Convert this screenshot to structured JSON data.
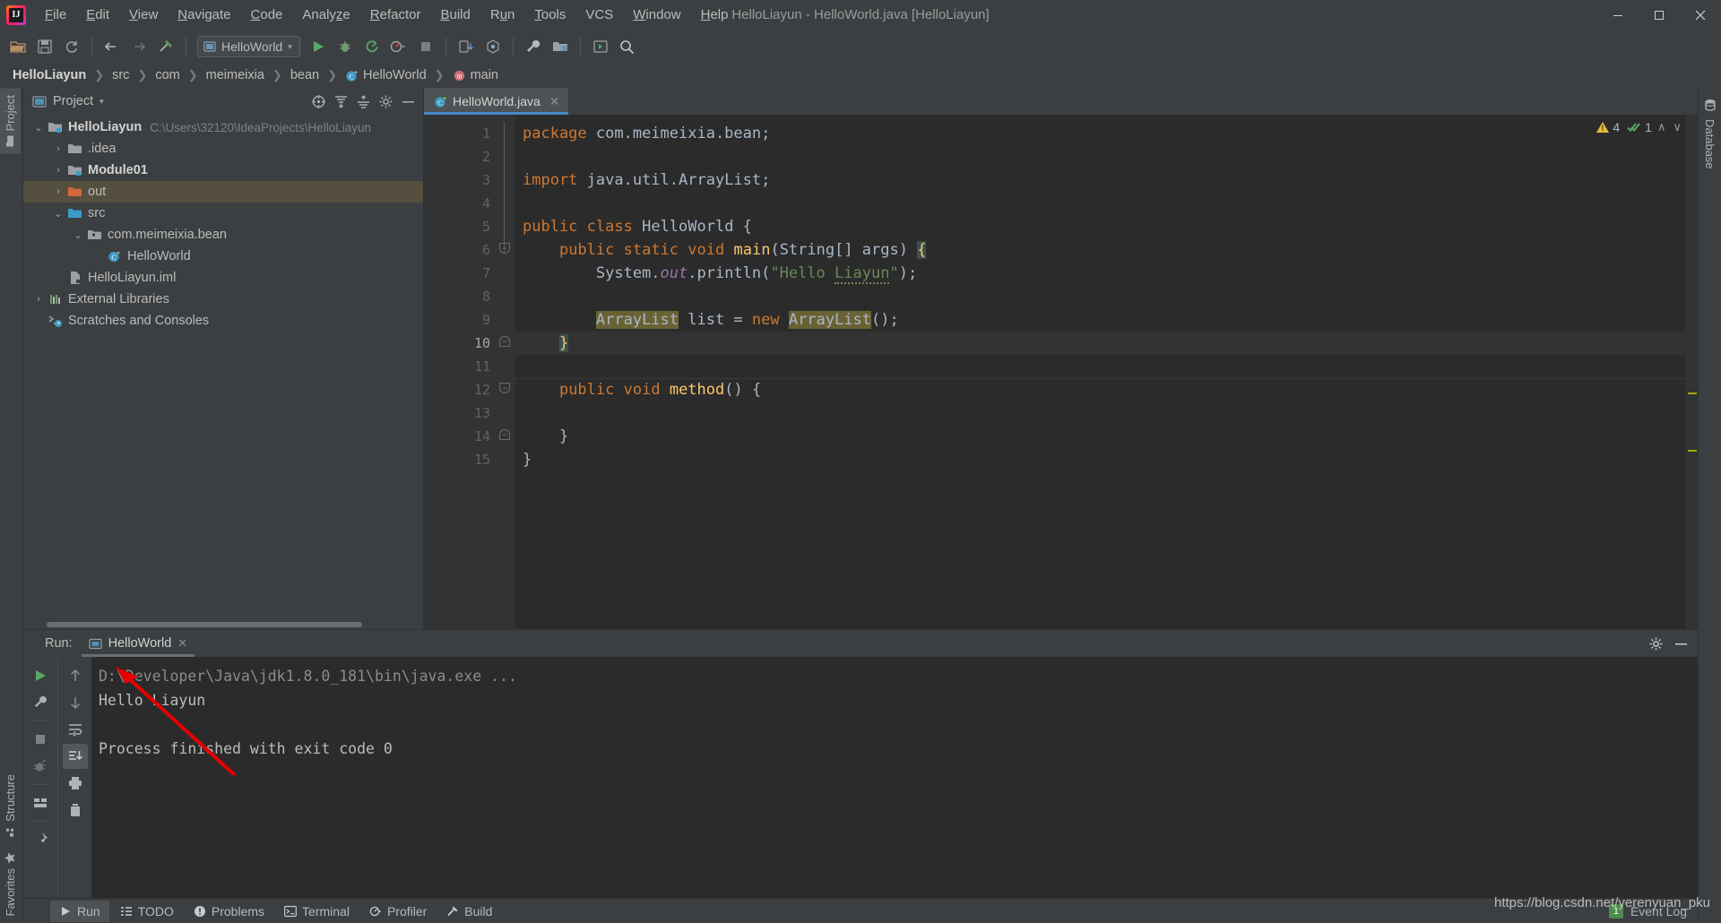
{
  "window": {
    "title": "HelloLiayun - HelloWorld.java [HelloLiayun]",
    "minimize": "–",
    "maximize": "❐",
    "close": "✕"
  },
  "menubar": {
    "items": [
      {
        "label": "File",
        "mnemonic": "F"
      },
      {
        "label": "Edit",
        "mnemonic": "E"
      },
      {
        "label": "View",
        "mnemonic": "V"
      },
      {
        "label": "Navigate",
        "mnemonic": "N"
      },
      {
        "label": "Code",
        "mnemonic": "C"
      },
      {
        "label": "Analyze",
        "mnemonic": "z"
      },
      {
        "label": "Refactor",
        "mnemonic": "R"
      },
      {
        "label": "Build",
        "mnemonic": "B"
      },
      {
        "label": "Run",
        "mnemonic": "u"
      },
      {
        "label": "Tools",
        "mnemonic": "T"
      },
      {
        "label": "VCS",
        "mnemonic": ""
      },
      {
        "label": "Window",
        "mnemonic": "W"
      },
      {
        "label": "Help",
        "mnemonic": "H"
      }
    ]
  },
  "toolbar": {
    "open_icon": "open-folder-icon",
    "save_icon": "save-all-icon",
    "sync_icon": "synchronize-icon",
    "back_icon": "navigate-back-icon",
    "forward_icon": "navigate-forward-icon",
    "build_icon": "build-hammer-icon",
    "run_config": "HelloWorld",
    "run_config_caret": "▾",
    "run_icon": "run-icon",
    "debug_icon": "debug-icon",
    "coverage_icon": "run-with-coverage-icon",
    "profile_icon": "profile-icon",
    "stop_icon": "stop-icon",
    "update_icon": "update-project-icon",
    "commit_icon": "commit-icon",
    "settings_icon": "settings-wrench-icon",
    "structure_icon": "project-structure-icon",
    "select_in_icon": "select-in-icon",
    "search_icon": "search-everywhere-icon"
  },
  "breadcrumb": {
    "separator": "❯",
    "items": [
      {
        "label": "HelloLiayun",
        "bold": true,
        "icon": ""
      },
      {
        "label": "src",
        "bold": false,
        "icon": ""
      },
      {
        "label": "com",
        "bold": false,
        "icon": ""
      },
      {
        "label": "meimeixia",
        "bold": false,
        "icon": ""
      },
      {
        "label": "bean",
        "bold": false,
        "icon": ""
      },
      {
        "label": "HelloWorld",
        "bold": false,
        "icon": "java-class-icon"
      },
      {
        "label": "main",
        "bold": false,
        "icon": "method-icon"
      }
    ]
  },
  "left_tool_tabs": [
    {
      "label": "Project",
      "icon": "project-folder-icon",
      "active": true
    },
    {
      "label": "Structure",
      "icon": "structure-icon",
      "active": false
    },
    {
      "label": "Favorites",
      "icon": "favorites-star-icon",
      "active": false
    }
  ],
  "right_tool_tabs": [
    {
      "label": "Database",
      "icon": "database-icon"
    }
  ],
  "project_panel": {
    "title": "Project",
    "caret": "▾",
    "actions": [
      {
        "name": "select-opened-file-icon",
        "label": "⊕"
      },
      {
        "name": "expand-all-icon",
        "label": "⤓"
      },
      {
        "name": "collapse-all-icon",
        "label": "⤒"
      },
      {
        "name": "settings-gear-icon",
        "label": "⚙"
      },
      {
        "name": "hide-panel-icon",
        "label": "–"
      }
    ],
    "tree": [
      {
        "label": "HelloLiayun",
        "path": "C:\\Users\\32120\\IdeaProjects\\HelloLiayun",
        "arrow": "⌄",
        "indent": 0,
        "icon": "project-root-icon",
        "bold": true,
        "selected": false
      },
      {
        "label": ".idea",
        "path": "",
        "arrow": "›",
        "indent": 1,
        "icon": "folder-icon",
        "bold": false,
        "selected": false
      },
      {
        "label": "Module01",
        "path": "",
        "arrow": "›",
        "indent": 1,
        "icon": "module-icon",
        "bold": true,
        "selected": false
      },
      {
        "label": "out",
        "path": "",
        "arrow": "›",
        "indent": 1,
        "icon": "folder-orange-icon",
        "bold": false,
        "selected": true
      },
      {
        "label": "src",
        "path": "",
        "arrow": "⌄",
        "indent": 1,
        "icon": "source-folder-icon",
        "bold": false,
        "selected": false
      },
      {
        "label": "com.meimeixia.bean",
        "path": "",
        "arrow": "⌄",
        "indent": 2,
        "icon": "package-icon",
        "bold": false,
        "selected": false
      },
      {
        "label": "HelloWorld",
        "path": "",
        "arrow": "",
        "indent": 3,
        "icon": "java-class-icon",
        "bold": false,
        "selected": false
      },
      {
        "label": "HelloLiayun.iml",
        "path": "",
        "arrow": "",
        "indent": 1,
        "icon": "iml-file-icon",
        "bold": false,
        "selected": false
      },
      {
        "label": "External Libraries",
        "path": "",
        "arrow": "›",
        "indent": 0,
        "icon": "libraries-icon",
        "bold": false,
        "selected": false
      },
      {
        "label": "Scratches and Consoles",
        "path": "",
        "arrow": "",
        "indent": 0,
        "icon": "scratches-icon",
        "bold": false,
        "selected": false
      }
    ]
  },
  "editor": {
    "tab": {
      "label": "HelloWorld.java",
      "icon": "java-class-icon",
      "close": "✕"
    },
    "inspections": {
      "warning_icon": "warning-triangle-icon",
      "warning_count": "4",
      "ok_icon": "inspection-ok-icon",
      "ok_count": "1",
      "up_chevron": "∧",
      "down_chevron": "∨"
    },
    "line_numbers": [
      "1",
      "2",
      "3",
      "4",
      "5",
      "6",
      "7",
      "8",
      "9",
      "10",
      "11",
      "12",
      "13",
      "14",
      "15"
    ],
    "current_line": 10,
    "run_markers": [
      5,
      6
    ],
    "lines": [
      {
        "n": 1,
        "tokens": [
          {
            "t": "package",
            "c": "k"
          },
          {
            "t": " com.meimeixia.bean;",
            "c": "t"
          }
        ]
      },
      {
        "n": 2,
        "tokens": []
      },
      {
        "n": 3,
        "tokens": [
          {
            "t": "import",
            "c": "k"
          },
          {
            "t": " java.util.ArrayList;",
            "c": "t"
          }
        ]
      },
      {
        "n": 4,
        "tokens": []
      },
      {
        "n": 5,
        "tokens": [
          {
            "t": "public",
            "c": "k"
          },
          {
            "t": " ",
            "c": "t"
          },
          {
            "t": "class",
            "c": "k"
          },
          {
            "t": " HelloWorld {",
            "c": "t"
          }
        ]
      },
      {
        "n": 6,
        "tokens": [
          {
            "t": "    ",
            "c": "t"
          },
          {
            "t": "public",
            "c": "k"
          },
          {
            "t": " ",
            "c": "t"
          },
          {
            "t": "static",
            "c": "k"
          },
          {
            "t": " ",
            "c": "t"
          },
          {
            "t": "void",
            "c": "k"
          },
          {
            "t": " ",
            "c": "t"
          },
          {
            "t": "main",
            "c": "fn"
          },
          {
            "t": "(String[] args) ",
            "c": "t"
          },
          {
            "t": "{",
            "c": "br brbg"
          }
        ]
      },
      {
        "n": 7,
        "tokens": [
          {
            "t": "        System.",
            "c": "t"
          },
          {
            "t": "out",
            "c": "fld"
          },
          {
            "t": ".println(",
            "c": "t"
          },
          {
            "t": "\"Hello ",
            "c": "s"
          },
          {
            "t": "Liayun",
            "c": "s wavy"
          },
          {
            "t": "\"",
            "c": "s"
          },
          {
            "t": ");",
            "c": "t"
          }
        ]
      },
      {
        "n": 8,
        "tokens": []
      },
      {
        "n": 9,
        "tokens": [
          {
            "t": "        ",
            "c": "t"
          },
          {
            "t": "ArrayList",
            "c": "t hl"
          },
          {
            "t": " list = ",
            "c": "t"
          },
          {
            "t": "new",
            "c": "k"
          },
          {
            "t": " ",
            "c": "t"
          },
          {
            "t": "ArrayList",
            "c": "t hl"
          },
          {
            "t": "();",
            "c": "t"
          }
        ]
      },
      {
        "n": 10,
        "tokens": [
          {
            "t": "    ",
            "c": "t"
          },
          {
            "t": "}",
            "c": "br brbg"
          }
        ]
      },
      {
        "n": 11,
        "tokens": []
      },
      {
        "n": 12,
        "tokens": [
          {
            "t": "    ",
            "c": "t"
          },
          {
            "t": "public",
            "c": "k"
          },
          {
            "t": " ",
            "c": "t"
          },
          {
            "t": "void",
            "c": "k"
          },
          {
            "t": " ",
            "c": "t"
          },
          {
            "t": "method",
            "c": "fn"
          },
          {
            "t": "() {",
            "c": "t"
          }
        ]
      },
      {
        "n": 13,
        "tokens": []
      },
      {
        "n": 14,
        "tokens": [
          {
            "t": "    }",
            "c": "t"
          }
        ]
      },
      {
        "n": 15,
        "tokens": [
          {
            "t": "}",
            "c": "t"
          }
        ]
      }
    ]
  },
  "run_panel": {
    "label": "Run:",
    "tab": {
      "label": "HelloWorld",
      "icon": "run-config-icon",
      "close": "✕"
    },
    "header_actions": [
      {
        "name": "settings-gear-icon",
        "label": "⚙"
      },
      {
        "name": "hide-panel-icon",
        "label": "–"
      }
    ],
    "left_tools": [
      {
        "name": "rerun-icon",
        "glyph": "▶",
        "color": "#59a869",
        "on": false
      },
      {
        "name": "edit-configuration-icon",
        "glyph": "wrench",
        "color": "#b0b2b4",
        "on": false
      },
      {
        "name": "stop-icon",
        "glyph": "■",
        "color": "#7f8284",
        "on": false
      },
      {
        "name": "stop-debug-icon",
        "glyph": "bug",
        "color": "#6f7274",
        "on": false
      },
      {
        "name": "layout-icon",
        "glyph": "layout",
        "color": "#b0b2b4",
        "on": false
      },
      {
        "name": "pin-tab-icon",
        "glyph": "pin",
        "color": "#b0b2b4",
        "on": false
      }
    ],
    "right_tools": [
      {
        "name": "up-arrow-icon",
        "glyph": "↑",
        "color": "#8b8d8f",
        "on": false
      },
      {
        "name": "down-arrow-icon",
        "glyph": "↓",
        "color": "#8b8d8f",
        "on": false
      },
      {
        "name": "soft-wrap-icon",
        "glyph": "wrap",
        "color": "#b0b2b4",
        "on": false
      },
      {
        "name": "scroll-to-end-icon",
        "glyph": "scroll",
        "color": "#cfcfcf",
        "on": true
      },
      {
        "name": "print-icon",
        "glyph": "print",
        "color": "#b0b2b4",
        "on": false
      },
      {
        "name": "clear-all-icon",
        "glyph": "trash",
        "color": "#b0b2b4",
        "on": false
      }
    ],
    "console": [
      {
        "text": "D:\\Developer\\Java\\jdk1.8.0_181\\bin\\java.exe ...",
        "dim": true
      },
      {
        "text": "Hello Liayun",
        "dim": false
      },
      {
        "text": "",
        "dim": false
      },
      {
        "text": "Process finished with exit code 0",
        "dim": false
      }
    ]
  },
  "statusbar": {
    "items": [
      {
        "label": "Run",
        "icon": "run-icon",
        "active": true
      },
      {
        "label": "TODO",
        "icon": "todo-icon",
        "active": false
      },
      {
        "label": "Problems",
        "icon": "problems-icon",
        "active": false
      },
      {
        "label": "Terminal",
        "icon": "terminal-icon",
        "active": false
      },
      {
        "label": "Profiler",
        "icon": "profiler-icon",
        "active": false
      },
      {
        "label": "Build",
        "icon": "build-icon",
        "active": false
      }
    ],
    "event_log": {
      "label": "Event Log",
      "badge": "1"
    }
  },
  "watermark": "https://blog.csdn.net/yerenyuan_pku",
  "colors": {
    "panel_bg": "#3c3f41",
    "editor_bg": "#2b2b2b",
    "gutter_bg": "#313335",
    "accent_blue": "#4a88c7",
    "selection_olive": "#554f3f",
    "keyword_orange": "#cc7832",
    "string_green": "#6a8759",
    "method_yellow": "#ffc66d",
    "field_purple": "#9876aa",
    "annotation_red": "#e60000"
  }
}
